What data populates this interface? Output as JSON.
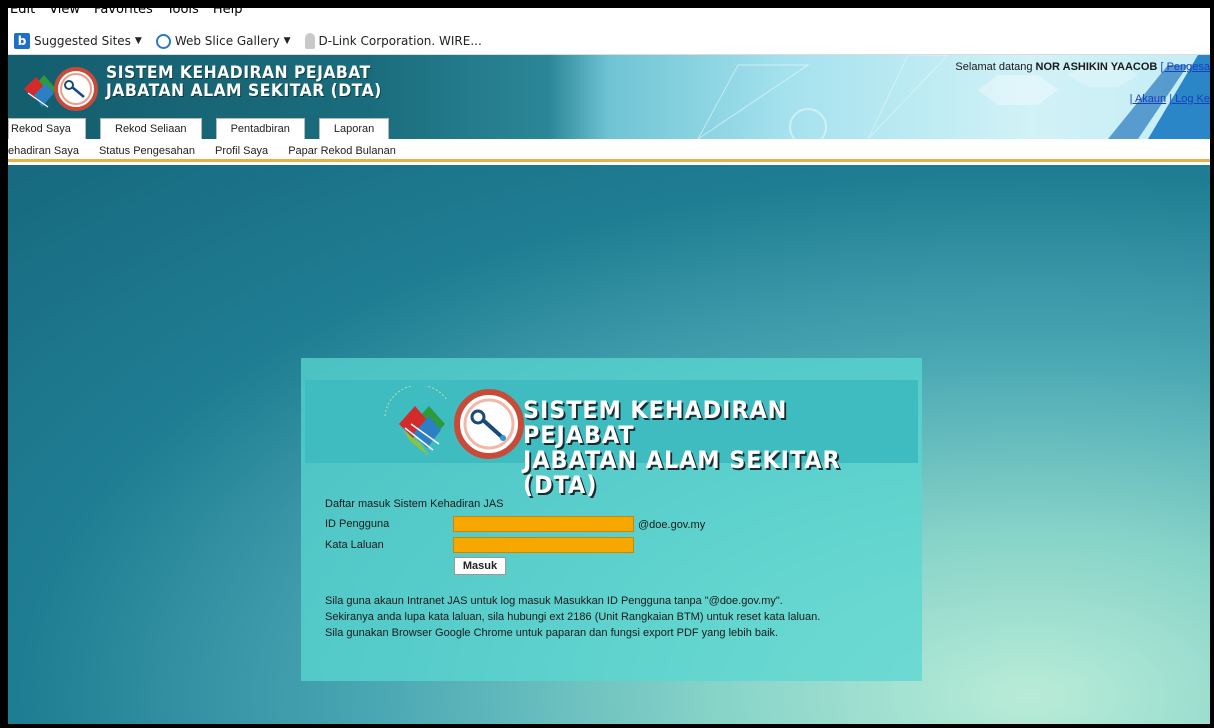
{
  "browser": {
    "menu": [
      "Edit",
      "View",
      "Favorites",
      "Tools",
      "Help"
    ],
    "favorites": [
      {
        "label": "Suggested Sites",
        "icon": "bing-icon",
        "dropdown": true
      },
      {
        "label": "Web Slice Gallery",
        "icon": "ie-icon",
        "dropdown": true
      },
      {
        "label": "D-Link Corporation. WIRE...",
        "icon": "dlink-icon",
        "dropdown": false
      }
    ]
  },
  "header": {
    "title_line1": "SISTEM KEHADIRAN PEJABAT",
    "title_line2": "JABATAN ALAM SEKITAR (DTA)",
    "welcome_prefix": "Selamat datang",
    "user_name": "NOR ASHIKIN YAACOB",
    "welcome_link": "[ Pengesa",
    "account_links": [
      "| Akaun",
      "| Log Ke"
    ]
  },
  "tabs": [
    "Rekod Saya",
    "Rekod Seliaan",
    "Pentadbiran",
    "Laporan"
  ],
  "subnav": [
    "ehadiran Saya",
    "Status Pengesahan",
    "Profil Saya",
    "Papar Rekod Bulanan"
  ],
  "login": {
    "banner_line1": "SISTEM KEHADIRAN PEJABAT",
    "banner_line2": "JABATAN ALAM SEKITAR (DTA)",
    "heading": "Daftar masuk Sistem Kehadiran JAS",
    "user_label": "ID Pengguna",
    "user_value": "",
    "user_suffix": "@doe.gov.my",
    "password_label": "Kata Laluan",
    "password_value": "",
    "submit_label": "Masuk",
    "notes": [
      "Sila guna akaun Intranet JAS untuk log masuk Masukkan ID Pengguna tanpa \"@doe.gov.my\".",
      "Sekiranya anda lupa kata laluan, sila hubungi ext 2186 (Unit Rangkaian BTM) untuk reset kata laluan.",
      "Sila gunakan Browser Google Chrome untuk paparan dan fungsi export PDF yang lebih baik."
    ]
  },
  "colors": {
    "input_fill": "#f7a800",
    "panel": "#5ad7d2",
    "banner": "#3fbcc0",
    "subnav_border": "#e8b04a"
  }
}
